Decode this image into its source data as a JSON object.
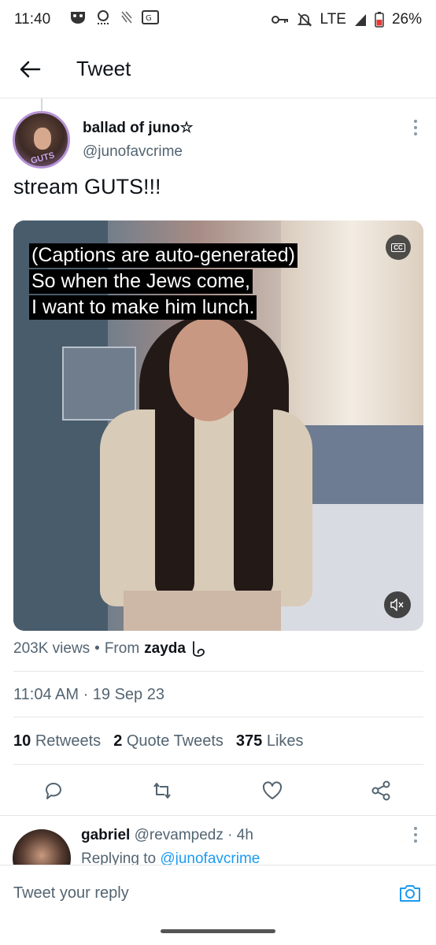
{
  "status_bar": {
    "time": "11:40",
    "network": "LTE",
    "battery": "26%"
  },
  "header": {
    "title": "Tweet"
  },
  "tweet": {
    "display_name": "ballad of juno☆",
    "handle": "@junofavcrime",
    "text": "stream GUTS!!!",
    "avatar_badge": "GUTS",
    "media": {
      "captions": [
        "(Captions are auto-generated)",
        "So when the Jews come,",
        "I want to make him lunch."
      ],
      "cc_label": "CC"
    },
    "views": "203K views",
    "from_prefix": "From",
    "from_name": "zayda",
    "timestamp": "11:04 AM · 19 Sep 23",
    "retweets_count": "10",
    "retweets_label": "Retweets",
    "quotes_count": "2",
    "quotes_label": "Quote Tweets",
    "likes_count": "375",
    "likes_label": "Likes"
  },
  "reply": {
    "display_name": "gabriel",
    "meta": "@revampedz · 4h",
    "replying_prefix": "Replying to",
    "replying_handle": "@junofavcrime"
  },
  "composer": {
    "placeholder": "Tweet your reply"
  },
  "colors": {
    "accent": "#1d9bf0",
    "text": "#0f1419",
    "secondary": "#536471"
  }
}
